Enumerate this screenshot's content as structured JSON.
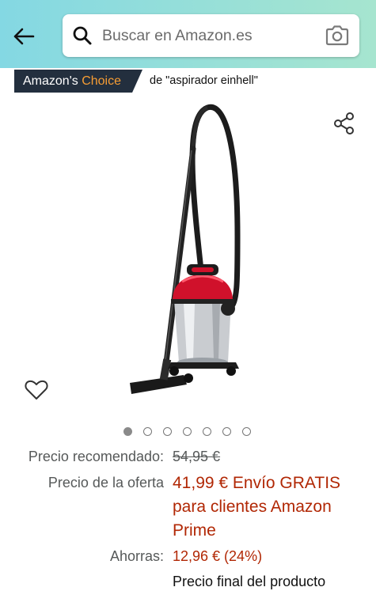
{
  "search": {
    "placeholder": "Buscar en Amazon.es"
  },
  "badge": {
    "amazons": "Amazon's",
    "choice": "Choice",
    "query": "de \"aspirador einhell\""
  },
  "images": {
    "count": 7,
    "active_index": 0
  },
  "pricing": {
    "recommended_label": "Precio recomendado:",
    "recommended_value": "54,95 €",
    "offer_label": "Precio de la oferta",
    "offer_value": "41,99 € Envío GRATIS para clientes Amazon Prime",
    "savings_label": "Ahorras:",
    "savings_value": "12,96 € (24%)",
    "final_note": "Precio final del producto"
  },
  "colors": {
    "header_gradient_start": "#84d8e3",
    "header_gradient_end": "#a6e5cf",
    "badge_bg": "#232f3e",
    "badge_accent": "#f79d34",
    "price_red": "#b12704",
    "muted_text": "#565959"
  }
}
